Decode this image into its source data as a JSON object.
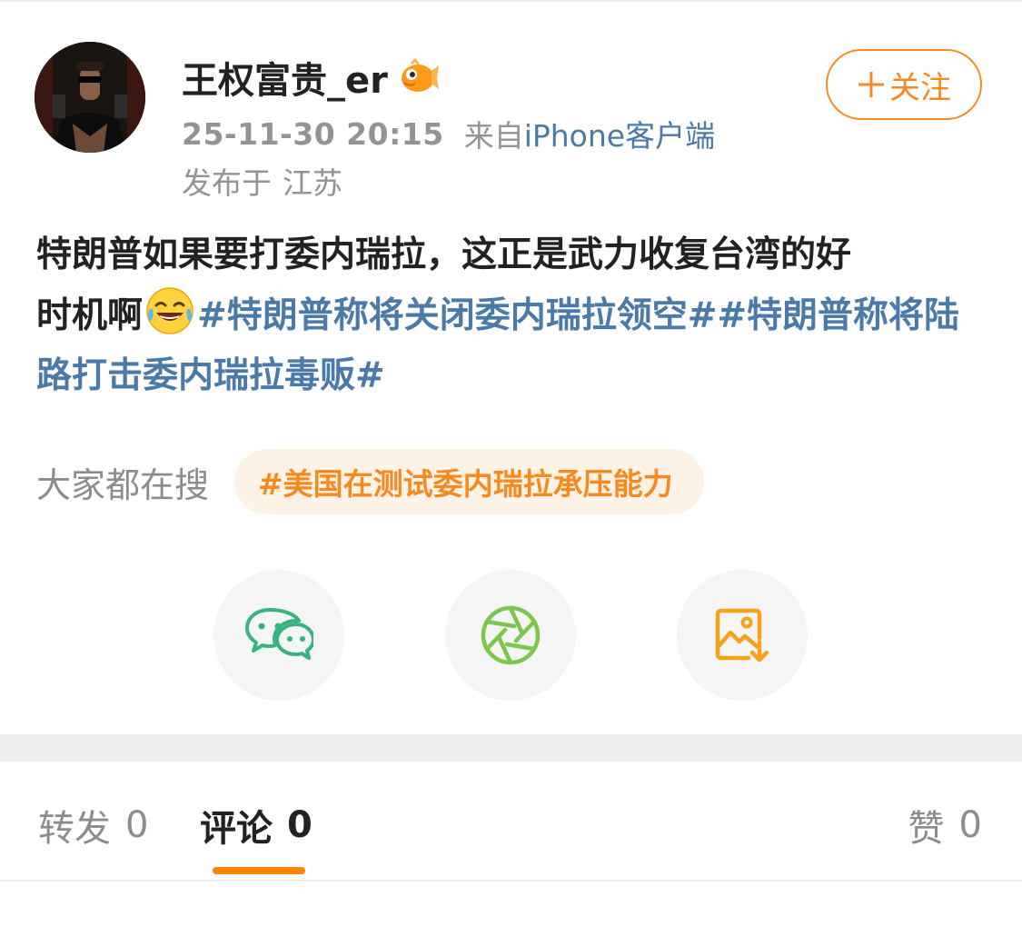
{
  "post": {
    "author": {
      "name": "王权富贵_er",
      "badge_icon": "vip-fish-icon"
    },
    "follow_button": {
      "label": "关注",
      "icon": "plus-icon",
      "color": "#f78a1f"
    },
    "meta": {
      "time": "25-11-30 20:15",
      "from_prefix": "来自",
      "device": "iPhone客户端",
      "location_label": "发布于",
      "location": "江苏"
    },
    "text_line1": "特朗普如果要打委内瑞拉，这正是武力收复台湾的好",
    "text_part2": "时机啊",
    "emoji": "laughing-tears-emoji",
    "topic1": "#特朗普称将关闭委内瑞拉领空#",
    "topic2": "#特朗普称将陆路打击委内瑞拉毒贩#",
    "topic_color": "#4a7aa7"
  },
  "search": {
    "label": "大家都在搜",
    "trend": "#美国在测试委内瑞拉承压能力"
  },
  "share_buttons": [
    {
      "icon": "wechat-icon"
    },
    {
      "icon": "moments-icon"
    },
    {
      "icon": "save-image-icon"
    }
  ],
  "tabs": {
    "repost": {
      "label": "转发",
      "count": "0"
    },
    "comment": {
      "label": "评论",
      "count": "0"
    },
    "like": {
      "label": "赞",
      "count": "0"
    },
    "indicator_color": "#ff8200"
  }
}
